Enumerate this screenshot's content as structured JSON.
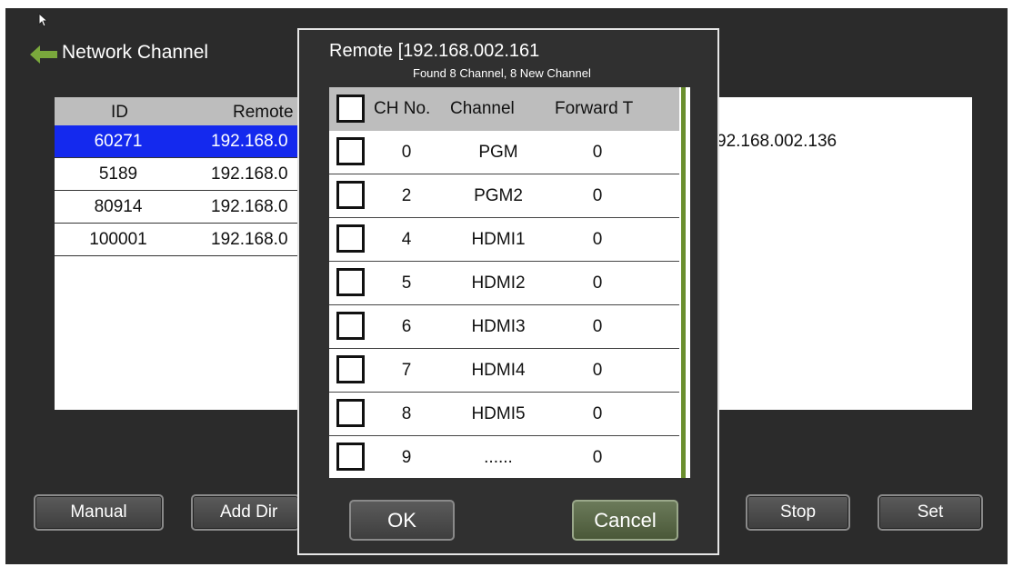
{
  "window": {
    "title": "Network Channel"
  },
  "list": {
    "headers": {
      "id": "ID",
      "remote": "Remote"
    },
    "rows": [
      {
        "id": "60271",
        "ip": "192.168.0",
        "selected": true
      },
      {
        "id": "5189",
        "ip": "192.168.0",
        "selected": false
      },
      {
        "id": "80914",
        "ip": "192.168.0",
        "selected": false
      },
      {
        "id": "100001",
        "ip": "192.168.0",
        "selected": false
      }
    ],
    "right_text": "92.168.002.136"
  },
  "buttons": {
    "manual": "Manual",
    "add_dir": "Add Dir",
    "stop": "Stop",
    "set": "Set"
  },
  "dialog": {
    "title": "Remote [192.168.002.161",
    "subtitle": "Found 8 Channel, 8 New Channel",
    "headers": {
      "ch_no": "CH No.",
      "channel": "Channel",
      "forward": "Forward T"
    },
    "rows": [
      {
        "no": "0",
        "name": "PGM",
        "fwd": "0"
      },
      {
        "no": "2",
        "name": "PGM2",
        "fwd": "0"
      },
      {
        "no": "4",
        "name": "HDMI1",
        "fwd": "0"
      },
      {
        "no": "5",
        "name": "HDMI2",
        "fwd": "0"
      },
      {
        "no": "6",
        "name": "HDMI3",
        "fwd": "0"
      },
      {
        "no": "7",
        "name": "HDMI4",
        "fwd": "0"
      },
      {
        "no": "8",
        "name": "HDMI5",
        "fwd": "0"
      },
      {
        "no": "9",
        "name": "......",
        "fwd": "0"
      }
    ],
    "ok": "OK",
    "cancel": "Cancel"
  },
  "colors": {
    "background": "#2b2b2b",
    "selection": "#1429ee",
    "back_arrow": "#7aa83c",
    "scrollbar": "#6b8f2e"
  }
}
